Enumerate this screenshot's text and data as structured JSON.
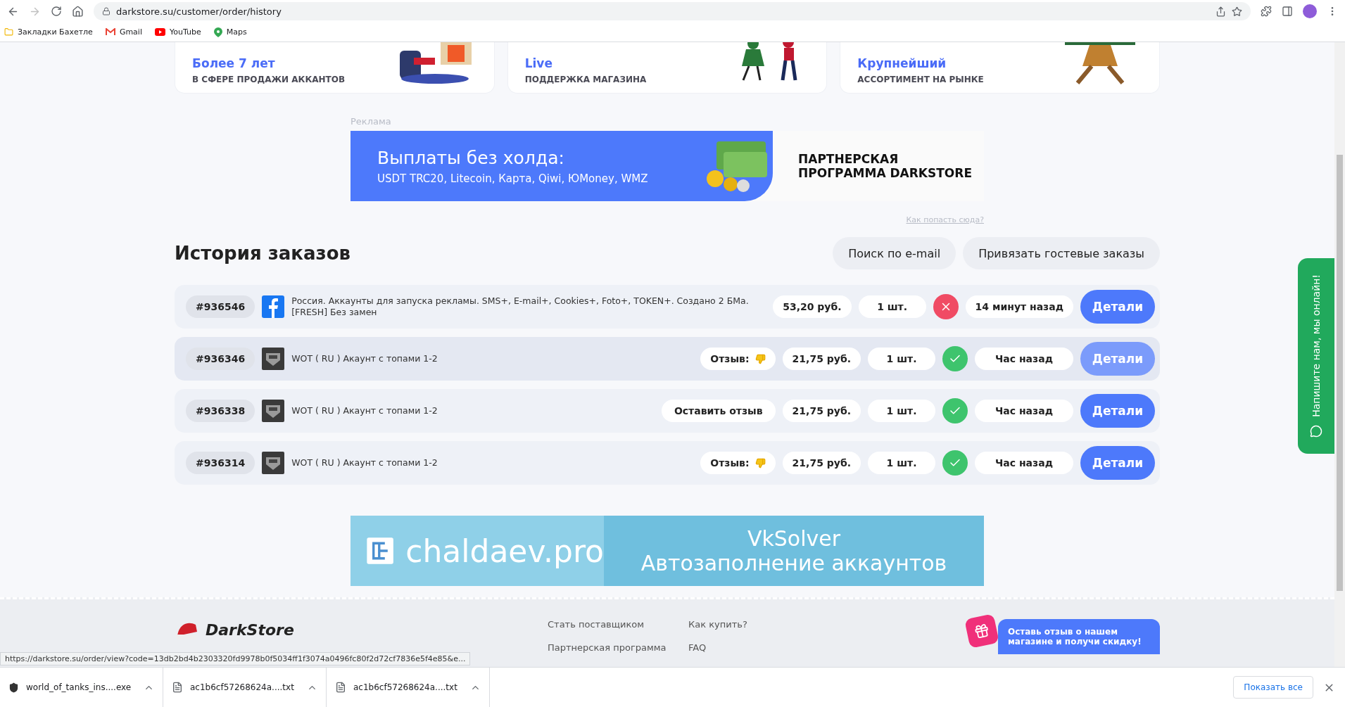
{
  "browser": {
    "url": "darkstore.su/customer/order/history",
    "bookmarks": [
      {
        "label": "Закладки Бахетле",
        "kind": "folder"
      },
      {
        "label": "Gmail",
        "kind": "gmail"
      },
      {
        "label": "YouTube",
        "kind": "youtube"
      },
      {
        "label": "Maps",
        "kind": "maps"
      }
    ]
  },
  "features": [
    {
      "title": "Более 7 лет",
      "subtitle": "В СФЕРЕ ПРОДАЖИ АККАНТОВ"
    },
    {
      "title": "Live",
      "subtitle": "ПОДДЕРЖКА МАГАЗИНА"
    },
    {
      "title": "Крупнейший",
      "subtitle": "АССОРТИМЕНТ НА РЫНКЕ"
    }
  ],
  "ad": {
    "label": "Реклама",
    "title": "Выплаты без холда:",
    "subtitle": "USDT TRC20, Litecoin, Карта, Qiwi, ЮMoney, WMZ",
    "partner": "ПАРТНЕРСКАЯ ПРОГРАММА DARKSTORE",
    "link": "Как попасть сюда?"
  },
  "history": {
    "title": "История заказов",
    "buttons": [
      "Поиск по e-mail",
      "Привязать гостевые заказы"
    ]
  },
  "orders": [
    {
      "id": "#936546",
      "kind": "facebook",
      "title": "Россия. Аккаунты для запуска рекламы. SMS+, E-mail+, Cookies+, Foto+, TOKEN+. Создано 2 БМа. [FRESH] Без замен",
      "review": {
        "kind": "none"
      },
      "price": "53,20 руб.",
      "qty": "1 шт.",
      "success": false,
      "time": "14 минут назад",
      "action": "Детали",
      "hovered": false
    },
    {
      "id": "#936346",
      "kind": "tank",
      "title": "WOT ( RU ) Акаунт с топами 1-2",
      "review": {
        "kind": "rating",
        "label": "Отзыв:"
      },
      "price": "21,75 руб.",
      "qty": "1 шт.",
      "success": true,
      "time": "Час назад",
      "action": "Детали",
      "hovered": true
    },
    {
      "id": "#936338",
      "kind": "tank",
      "title": "WOT ( RU ) Акаунт с топами 1-2",
      "review": {
        "kind": "leave",
        "label": "Оставить отзыв"
      },
      "price": "21,75 руб.",
      "qty": "1 шт.",
      "success": true,
      "time": "Час назад",
      "action": "Детали",
      "hovered": false
    },
    {
      "id": "#936314",
      "kind": "tank",
      "title": "WOT ( RU ) Акаунт с топами 1-2",
      "review": {
        "kind": "rating",
        "label": "Отзыв:"
      },
      "price": "21,75 руб.",
      "qty": "1 шт.",
      "success": true,
      "time": "Час назад",
      "action": "Детали",
      "hovered": false
    }
  ],
  "ad2": {
    "brand": "chaldaev.pro",
    "product": "VkSolver",
    "slogan": "Автозаполнение аккаунтов"
  },
  "footer": {
    "logo": "DarkStore",
    "links": [
      [
        "Стать поставщиком",
        "Партнерская программа"
      ],
      [
        "Как купить?",
        "FAQ"
      ]
    ],
    "promo": "Оставь отзыв о нашем магазине и получи скидку!"
  },
  "chat": "Напишите нам, мы онлайн!",
  "status_url": "https://darkstore.su/order/view?code=13db2bd4b2303320fd9978b0f5034ff1f3074a0496fc80f2d72cf7836e5f4e85&e...",
  "downloads": {
    "items": [
      {
        "name": "world_of_tanks_ins....exe",
        "kind": "exe"
      },
      {
        "name": "ac1b6cf57268624a....txt",
        "kind": "txt"
      },
      {
        "name": "ac1b6cf57268624a....txt",
        "kind": "txt"
      }
    ],
    "show_all": "Показать все"
  }
}
